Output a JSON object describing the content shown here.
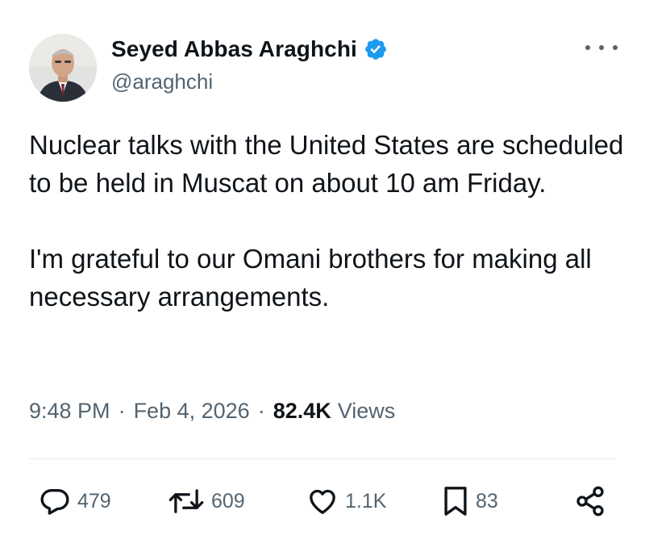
{
  "author": {
    "display_name": "Seyed Abbas Araghchi",
    "handle": "@araghchi",
    "verified_icon": "verified-badge-icon"
  },
  "tweet": {
    "paragraphs": [
      "Nuclear talks with the United States are scheduled to be held in Muscat on about 10 am Friday.",
      "I'm grateful to our Omani brothers for making all necessary arrangements."
    ],
    "time": "9:48 PM",
    "date": "Feb 4, 2026",
    "separator": "·",
    "views_count": "82.4K",
    "views_label": "Views"
  },
  "actions": {
    "replies": "479",
    "reposts": "609",
    "likes": "1.1K",
    "bookmarks": "83"
  },
  "colors": {
    "text": "#0f1419",
    "muted": "#536471",
    "verified": "#1d9bf0",
    "divider": "#e6ecf0"
  }
}
